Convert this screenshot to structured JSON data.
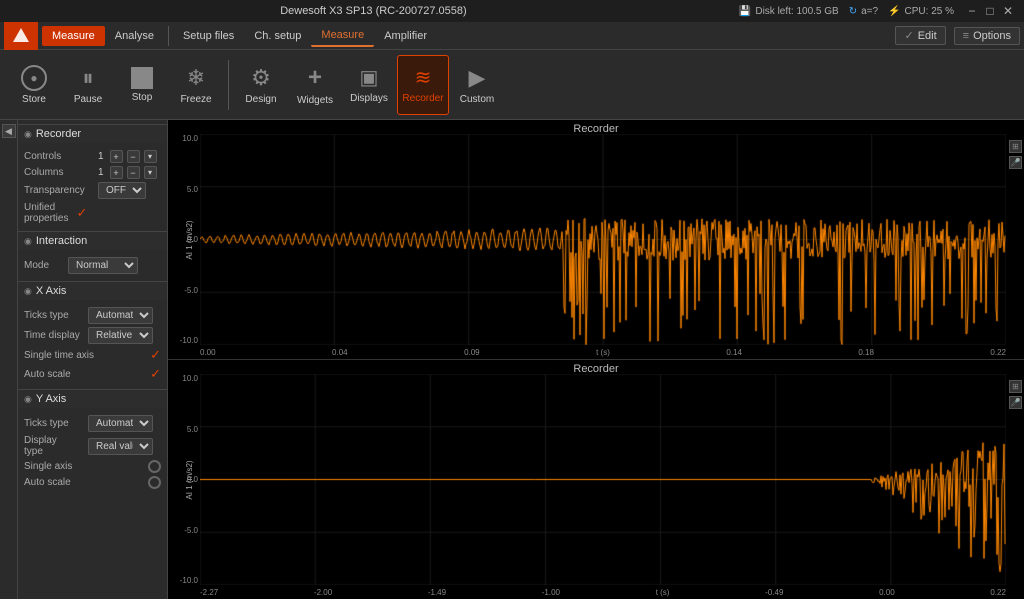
{
  "titlebar": {
    "title": "Dewesoft X3 SP13 (RC-200727.0558)",
    "disk_left_label": "Disk left: 100.5 GB",
    "cpu_label": "CPU: 25 %",
    "loading_label": "a=?",
    "edit_label": "Edit",
    "options_label": "Options",
    "min_btn": "−",
    "max_btn": "□",
    "close_btn": "✕"
  },
  "menubar": {
    "logo_alt": "Dewesoft logo",
    "items": [
      {
        "id": "measure",
        "label": "Measure",
        "active": true
      },
      {
        "id": "analyse",
        "label": "Analyse",
        "active": false
      },
      {
        "id": "setup-files",
        "label": "Setup files",
        "active": false
      },
      {
        "id": "ch-setup",
        "label": "Ch. setup",
        "active": false
      },
      {
        "id": "measure-tab",
        "label": "Measure",
        "tab_active": true
      },
      {
        "id": "amplifier",
        "label": "Amplifier",
        "active": false
      }
    ]
  },
  "toolbar": {
    "buttons": [
      {
        "id": "store",
        "label": "Store",
        "icon": "⏺",
        "active": false
      },
      {
        "id": "pause",
        "label": "Pause",
        "icon": "⏸",
        "active": false
      },
      {
        "id": "stop",
        "label": "Stop",
        "icon": "⏹",
        "active": false
      },
      {
        "id": "freeze",
        "label": "Freeze",
        "icon": "❄",
        "active": false
      },
      {
        "id": "design",
        "label": "Design",
        "icon": "⚙",
        "active": false
      },
      {
        "id": "widgets",
        "label": "Widgets",
        "icon": "+",
        "active": false
      },
      {
        "id": "displays",
        "label": "Displays",
        "icon": "▣",
        "active": false
      },
      {
        "id": "recorder",
        "label": "Recorder",
        "icon": "🎵",
        "active": true
      },
      {
        "id": "custom",
        "label": "Custom",
        "icon": "▶",
        "active": false
      }
    ]
  },
  "sidebar": {
    "collapse_btn": "<",
    "sections": [
      {
        "id": "recorder",
        "title": "Recorder",
        "properties": [
          {
            "label": "Controls",
            "value": "1",
            "has_controls": true
          },
          {
            "label": "Columns",
            "value": "1",
            "has_controls": true
          },
          {
            "label": "Transparency",
            "value": "OFF",
            "has_dropdown": true
          },
          {
            "label": "Unified",
            "sub": "properties",
            "has_check": true
          }
        ]
      },
      {
        "id": "interaction",
        "title": "Interaction",
        "properties": [
          {
            "label": "Mode",
            "value": "Normal",
            "has_dropdown": true
          }
        ]
      },
      {
        "id": "xaxis",
        "title": "X Axis",
        "properties": [
          {
            "label": "Ticks type",
            "value": "Automatic",
            "has_dropdown": true
          },
          {
            "label": "Time display",
            "value": "Relative",
            "has_dropdown": true
          },
          {
            "label": "Single time axis",
            "has_check": true
          },
          {
            "label": "Auto scale",
            "has_check": true
          }
        ]
      },
      {
        "id": "yaxis",
        "title": "Y Axis",
        "properties": [
          {
            "label": "Ticks type",
            "value": "Automatic",
            "has_dropdown": true
          },
          {
            "label": "Display type",
            "sub": "type",
            "value": "Real value",
            "has_dropdown": true
          },
          {
            "label": "Single axis",
            "has_circle": true
          },
          {
            "label": "Auto scale",
            "has_circle": true
          }
        ]
      }
    ]
  },
  "charts": [
    {
      "id": "chart1",
      "title": "Recorder",
      "y_label": "AI 1 (m/s2)",
      "y_ticks": [
        "10.0",
        "5.0",
        "0.0",
        "-5.0",
        "-10.0"
      ],
      "x_ticks": [
        "0.00",
        "0.04",
        "0.09",
        "0.14",
        "0.18",
        "0.22"
      ],
      "x_axis_label": "t (s)"
    },
    {
      "id": "chart2",
      "title": "Recorder",
      "y_label": "AI 1 (m/s2)",
      "y_ticks": [
        "10.0",
        "5.0",
        "0.0",
        "-5.0",
        "-10.0"
      ],
      "x_ticks": [
        "-2.27",
        "-2.00",
        "-1.49",
        "-1.00",
        "-0.49",
        "0.00",
        "0.22"
      ],
      "x_axis_label": "t (s)"
    }
  ],
  "colors": {
    "accent": "#e04000",
    "signal": "#ff8800",
    "bg_chart": "#000000",
    "bg_sidebar": "#2b2b2b",
    "text_main": "#cccccc"
  }
}
